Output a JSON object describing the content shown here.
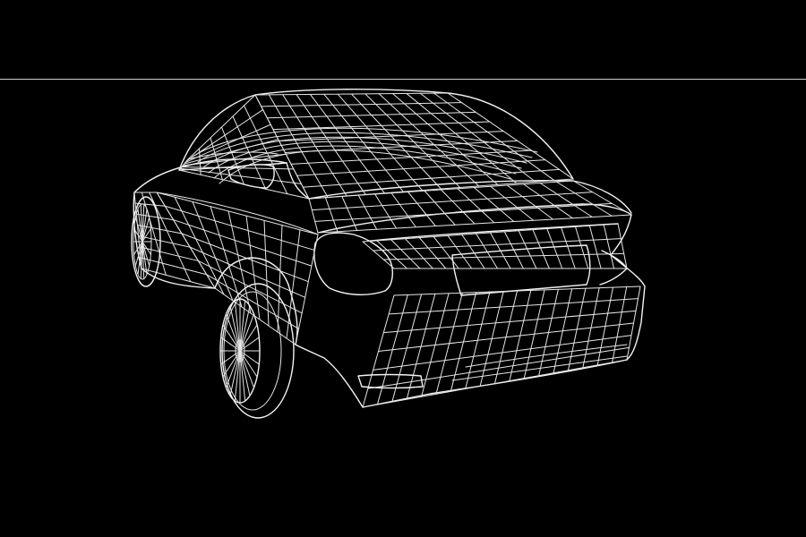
{
  "scene": {
    "background_color": "#000000",
    "line_color": "#e6e6e6",
    "horizon_color": "#cfcfcf",
    "subject": "wireframe-car-rear-three-quarter"
  }
}
